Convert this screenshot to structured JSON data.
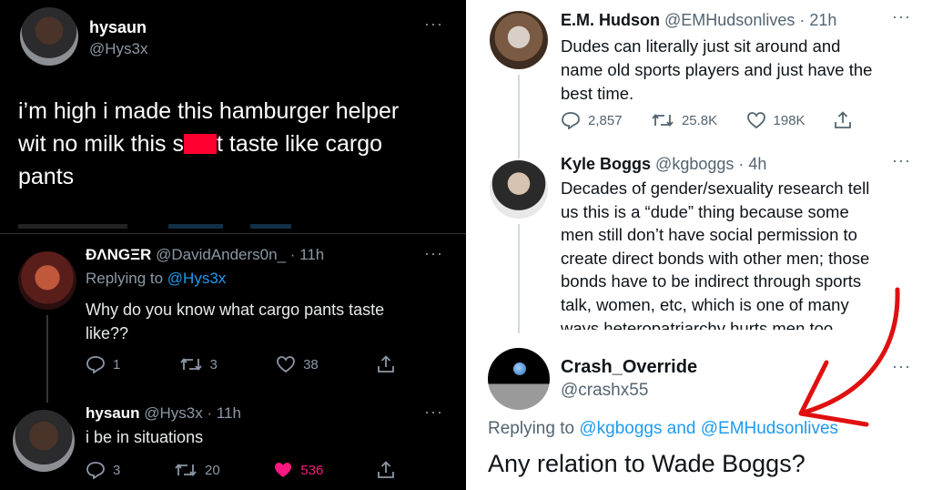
{
  "left": {
    "main_tweet": {
      "display_name": "hysaun",
      "handle": "@Hys3x",
      "text_part1": "i’m high i made this hamburger helper",
      "text_part2": "wit no milk this s",
      "text_part3": "t taste like cargo",
      "text_part4": "pants",
      "more": "···"
    },
    "reply1": {
      "display_name": "ÐΛNGΞR",
      "handle_time": "@DavidAnders0n_ · 11h",
      "replying_prefix": "Replying to ",
      "replying_handle": "@Hys3x",
      "text_line1": "Why do you know what cargo pants taste",
      "text_line2": "like??",
      "replies": "1",
      "retweets": "3",
      "likes": "38",
      "more": "···"
    },
    "reply2": {
      "display_name": "hysaun",
      "handle_time": "@Hys3x · 11h",
      "text": "i be in situations",
      "replies": "3",
      "retweets": "20",
      "likes": "536",
      "more": "···"
    }
  },
  "right": {
    "tweet1": {
      "display_name": "E.M. Hudson",
      "handle_time": "@EMHudsonlives · 21h",
      "lines": [
        "Dudes can literally just sit around and",
        "name old sports players and just have the",
        "best time."
      ],
      "replies": "2,857",
      "retweets": "25.8K",
      "likes": "198K",
      "more": "···"
    },
    "tweet2": {
      "display_name": "Kyle Boggs",
      "handle_time": "@kgboggs · 4h",
      "lines": [
        "Decades of gender/sexuality research tell",
        "us this is a “dude” thing because some",
        "men still don’t have social permission to",
        "create direct bonds with other men; those",
        "bonds have to be indirect through sports",
        "talk, women, etc, which is one of many",
        "ways heteropatriarchy hurts men too"
      ],
      "more": "···"
    },
    "tweet3": {
      "display_name": "Crash_Override",
      "handle": "@crashx55",
      "replying_prefix": "Replying to ",
      "replying_handle1": "@kgboggs",
      "replying_and": " and ",
      "replying_handle2": "@EMHudsonlives",
      "text": "Any relation to Wade Boggs?",
      "more": "···"
    }
  },
  "colors": {
    "dark_bg": "#000000",
    "light_bg": "#ffffff",
    "link": "#1d9bf0",
    "like_active": "#f91880",
    "censor": "#ff0030",
    "arrow": "#e01010"
  }
}
